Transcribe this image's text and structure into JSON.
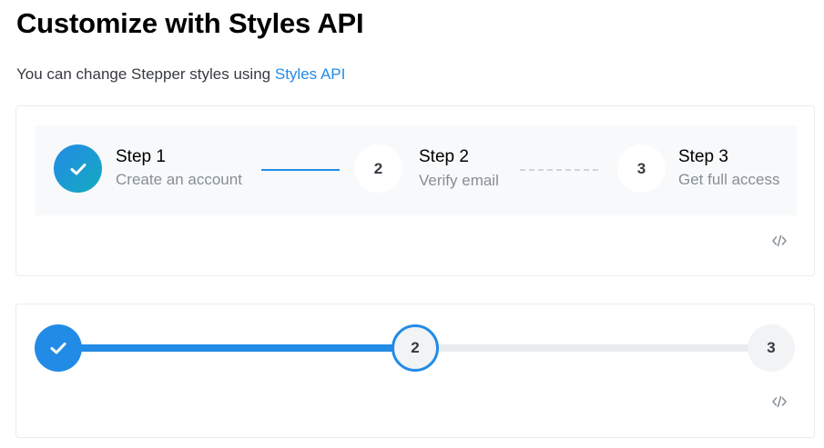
{
  "page": {
    "title": "Customize with Styles API",
    "intro_text": "You can change Stepper styles using ",
    "intro_link": "Styles API"
  },
  "demo1": {
    "steps": [
      {
        "label": "Step 1",
        "description": "Create an account",
        "icon": "check-icon",
        "state": "completed"
      },
      {
        "label": "Step 2",
        "description": "Verify email",
        "number": "2",
        "state": "active"
      },
      {
        "label": "Step 3",
        "description": "Get full access",
        "number": "3",
        "state": "inactive"
      }
    ],
    "code_icon": "code-icon"
  },
  "demo2": {
    "steps": [
      {
        "icon": "check-icon",
        "state": "completed"
      },
      {
        "number": "2",
        "state": "active"
      },
      {
        "number": "3",
        "state": "inactive"
      }
    ],
    "progress_fraction": 0.5,
    "code_icon": "code-icon"
  },
  "colors": {
    "accent": "#228be6",
    "accent_gradient_end": "#15aabf",
    "muted_text": "#868e96",
    "track": "#e9ecef",
    "panel_bg": "#f8f9fa"
  }
}
